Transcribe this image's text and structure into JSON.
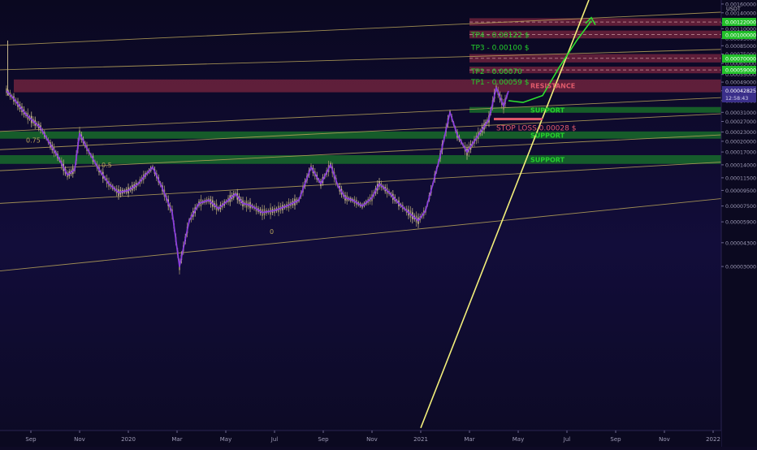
{
  "chart_data": {
    "type": "line",
    "price_axis": {
      "unit": "USDT",
      "scale": "log",
      "ylim": [
        2.5e-06,
        0.0017
      ],
      "ticks": [
        "0.00160000",
        "0.00140000",
        "0.00120000",
        "0.00110000",
        "0.00095000",
        "0.00085000",
        "0.00075000",
        "0.00065000",
        "0.00055000",
        "0.00049000",
        "0.00043000",
        "0.00037000",
        "0.00031000",
        "0.00027000",
        "0.00023000",
        "0.00020000",
        "0.00017000",
        "0.00014000",
        "0.00011500",
        "0.00009500",
        "0.00007500",
        "0.00005900",
        "0.00004300",
        "0.00003000"
      ],
      "tick_values": [
        0.0016,
        0.0014,
        0.0012,
        0.0011,
        0.00095,
        0.00085,
        0.00075,
        0.00065,
        0.00055,
        0.00049,
        0.00043,
        0.00037,
        0.00031,
        0.00027,
        0.00023,
        0.0002,
        0.00017,
        0.00014,
        0.000115,
        9.5e-05,
        7.5e-05,
        5.9e-05,
        4.3e-05,
        3e-05
      ]
    },
    "time_axis": {
      "labels": [
        "Sep",
        "Nov",
        "2020",
        "Mar",
        "May",
        "Jul",
        "Sep",
        "Nov",
        "2021",
        "Mar",
        "May",
        "Jul",
        "Sep",
        "Nov",
        "2022"
      ],
      "month_index": [
        0,
        2,
        4,
        6,
        8,
        10,
        12,
        14,
        16,
        18,
        20,
        22,
        24,
        26,
        28
      ]
    },
    "price_badges": [
      {
        "text": "0.00122000",
        "value": 0.00122,
        "color": "#22c12a"
      },
      {
        "text": "0.00100000",
        "value": 0.001,
        "color": "#22c12a"
      },
      {
        "text": "0.00070000",
        "value": 0.0007,
        "color": "#22c12a"
      },
      {
        "text": "0.00059000",
        "value": 0.00059,
        "color": "#22c12a"
      }
    ],
    "current_price": {
      "text": "0.00042825",
      "countdown": "12:58:43",
      "value": 0.00042825,
      "color": "#3a2f8a"
    },
    "zones": [
      {
        "label": "TP4 - 0.00122 $",
        "from": 0.00115,
        "to": 0.00129,
        "kind": "target",
        "start_month": 18.0
      },
      {
        "label": "TP3 - 0.00100 $",
        "from": 0.00095,
        "to": 0.00107,
        "kind": "target",
        "start_month": 18.0
      },
      {
        "label": "TP2 - 0.00070",
        "from": 0.00066,
        "to": 0.00075,
        "kind": "target",
        "start_month": 18.0
      },
      {
        "label": "TP1 - 0.00059 $",
        "from": 0.00056,
        "to": 0.00062,
        "kind": "target",
        "start_month": 18.0
      },
      {
        "label": "RESISTANCE",
        "from": 0.00042,
        "to": 0.00051,
        "kind": "resistance",
        "start_month": -0.7
      },
      {
        "label": "SUPPORT",
        "from": 0.000308,
        "to": 0.000336,
        "kind": "support",
        "start_month": 18.0
      },
      {
        "label": "SUPPORT",
        "from": 0.000208,
        "to": 0.000232,
        "kind": "support",
        "start_month": -1.3
      },
      {
        "label": "SUPPORT",
        "from": 0.000142,
        "to": 0.000162,
        "kind": "support",
        "start_month": -1.3
      }
    ],
    "stop_loss": {
      "label": "STOP LOSS 0.00028 $",
      "value": 0.00028,
      "from_month": 19.0,
      "to_month": 21.0
    },
    "fib_labels": [
      {
        "text": "0.75",
        "month": -0.2,
        "value": 0.000196
      },
      {
        "text": "0.5",
        "month": 2.9,
        "value": 0.000135
      },
      {
        "text": "0",
        "month": 9.8,
        "value": 4.9e-05
      }
    ],
    "channel_lines": [
      {
        "from": [
          -1.3,
          0.000855
        ],
        "to": [
          29.0,
          0.00143
        ]
      },
      {
        "from": [
          -1.3,
          0.00059
        ],
        "to": [
          29.0,
          0.00081
        ]
      },
      {
        "from": [
          -1.3,
          0.000232
        ],
        "to": [
          29.0,
          0.000392
        ]
      },
      {
        "from": [
          -1.3,
          0.000176
        ],
        "to": [
          29.0,
          0.000307
        ]
      },
      {
        "from": [
          -1.3,
          0.000128
        ],
        "to": [
          29.0,
          0.000223
        ]
      },
      {
        "from": [
          -1.3,
          7.8e-05
        ],
        "to": [
          29.0,
          0.000148
        ]
      },
      {
        "from": [
          -1.3,
          2.8e-05
        ],
        "to": [
          29.0,
          8.6e-05
        ]
      }
    ],
    "trendline": {
      "from": [
        16.0,
        2.6e-06
      ],
      "to": [
        22.9,
        0.0017
      ]
    },
    "price_path": [
      [
        -1.0,
        0.00043
      ],
      [
        -0.7,
        0.00038
      ],
      [
        -0.2,
        0.0003
      ],
      [
        0.4,
        0.000245
      ],
      [
        0.8,
        0.00019
      ],
      [
        1.1,
        0.00016
      ],
      [
        1.5,
        0.00012
      ],
      [
        1.8,
        0.00013
      ],
      [
        2.0,
        0.000225
      ],
      [
        2.3,
        0.00018
      ],
      [
        2.8,
        0.00013
      ],
      [
        3.2,
        0.000105
      ],
      [
        3.6,
        9.2e-05
      ],
      [
        4.0,
        9.5e-05
      ],
      [
        4.4,
        0.000105
      ],
      [
        4.7,
        0.00012
      ],
      [
        5.0,
        0.000135
      ],
      [
        5.4,
        9.8e-05
      ],
      [
        5.8,
        6.8e-05
      ],
      [
        6.1,
        3e-05
      ],
      [
        6.5,
        6e-05
      ],
      [
        6.9,
        7.8e-05
      ],
      [
        7.3,
        8.2e-05
      ],
      [
        7.7,
        7.2e-05
      ],
      [
        8.1,
        8.2e-05
      ],
      [
        8.4,
        9e-05
      ],
      [
        8.7,
        7.8e-05
      ],
      [
        9.0,
        7.6e-05
      ],
      [
        9.5,
        6.8e-05
      ],
      [
        10.0,
        7e-05
      ],
      [
        10.5,
        7.5e-05
      ],
      [
        11.0,
        8.2e-05
      ],
      [
        11.5,
        0.000135
      ],
      [
        11.9,
        0.000105
      ],
      [
        12.3,
        0.00014
      ],
      [
        12.6,
        0.000102
      ],
      [
        12.9,
        8.5e-05
      ],
      [
        13.2,
        8.2e-05
      ],
      [
        13.6,
        7.5e-05
      ],
      [
        14.0,
        8.5e-05
      ],
      [
        14.3,
        0.000105
      ],
      [
        14.7,
        9.2e-05
      ],
      [
        15.1,
        7.8e-05
      ],
      [
        15.5,
        6.8e-05
      ],
      [
        15.9,
        6e-05
      ],
      [
        16.2,
        7e-05
      ],
      [
        16.5,
        0.000105
      ],
      [
        16.8,
        0.00016
      ],
      [
        17.2,
        0.00031
      ],
      [
        17.5,
        0.00022
      ],
      [
        17.9,
        0.00017
      ],
      [
        18.2,
        0.0002
      ],
      [
        18.6,
        0.00025
      ],
      [
        18.8,
        0.00028
      ],
      [
        19.1,
        0.00045
      ],
      [
        19.4,
        0.00034
      ],
      [
        19.6,
        0.00042825
      ]
    ],
    "projection": [
      [
        19.6,
        0.00037
      ],
      [
        20.2,
        0.00036
      ],
      [
        21.0,
        0.0004
      ],
      [
        21.7,
        0.00062
      ],
      [
        22.4,
        0.00092
      ],
      [
        23.0,
        0.00124
      ]
    ]
  }
}
